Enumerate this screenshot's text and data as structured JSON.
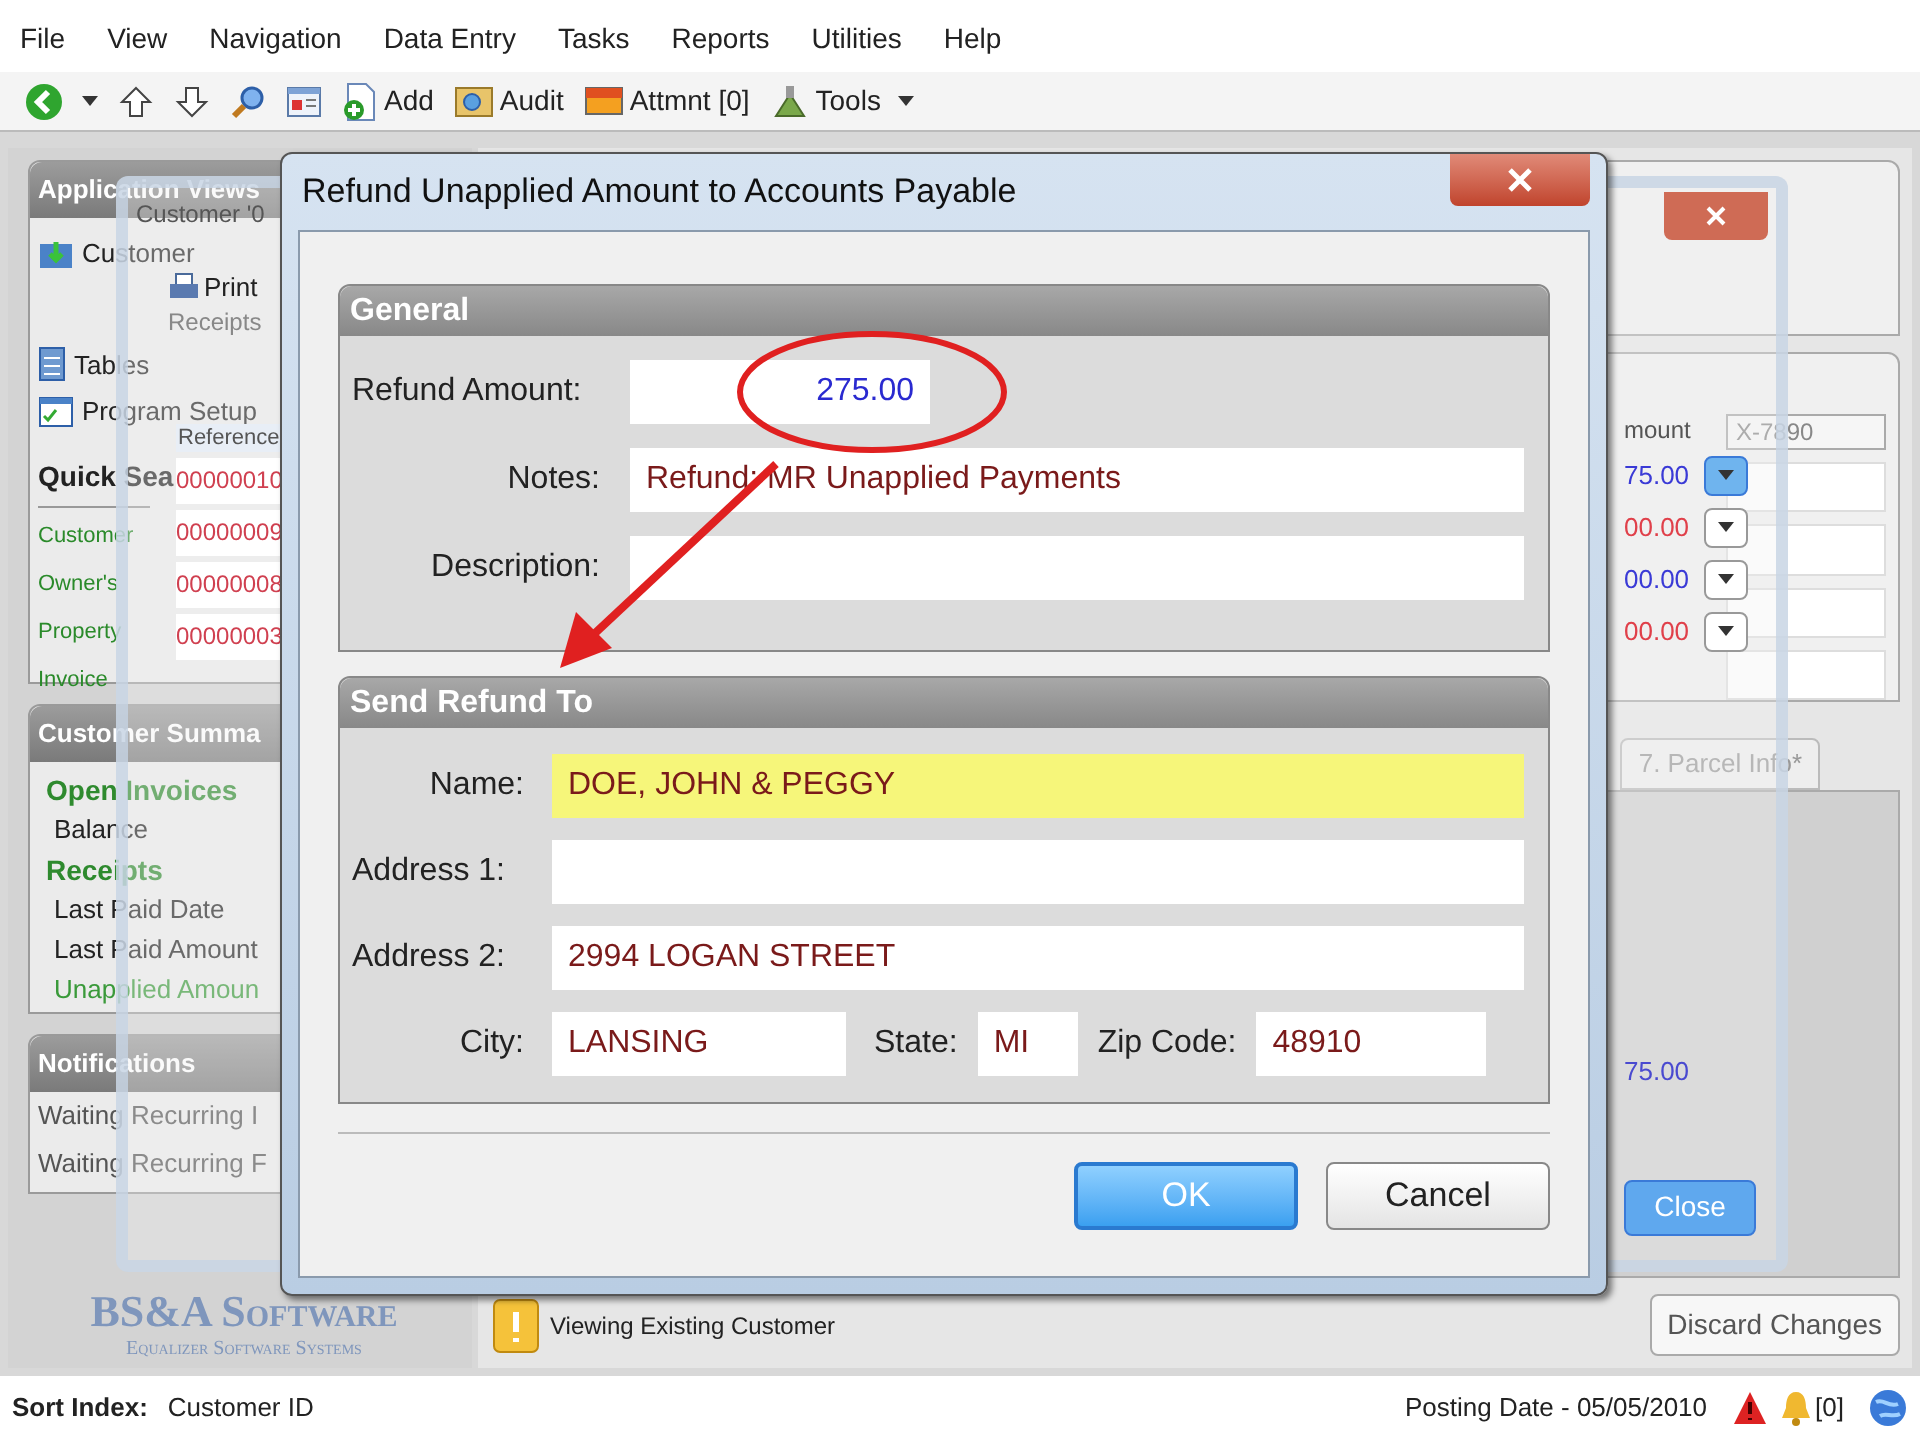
{
  "menu": [
    "File",
    "View",
    "Navigation",
    "Data Entry",
    "Tasks",
    "Reports",
    "Utilities",
    "Help"
  ],
  "toolbar": [
    {
      "kind": "back"
    },
    {
      "kind": "up"
    },
    {
      "kind": "down"
    },
    {
      "kind": "search"
    },
    {
      "kind": "form"
    },
    {
      "kind": "add",
      "label": "Add"
    },
    {
      "kind": "audit",
      "label": "Audit"
    },
    {
      "kind": "attachment",
      "label": "Attmnt [0]"
    },
    {
      "kind": "tools",
      "label": "Tools"
    }
  ],
  "left_panel": {
    "application_views": {
      "title": "Application Views",
      "items": [
        {
          "label": "Customer",
          "kind": "folder"
        },
        {
          "label": "Tables",
          "kind": "table"
        },
        {
          "label": "Program Setup",
          "kind": "setup"
        }
      ]
    },
    "quick_search": {
      "title": "Quick Sea",
      "items": [
        "Customer",
        "Owner's",
        "Property",
        "Invoice"
      ]
    },
    "customer_summary": {
      "title": "Customer Summa",
      "items": [
        {
          "label": "Open Invoices",
          "kind": "heading"
        },
        {
          "label": "Balance",
          "kind": "line"
        },
        {
          "label": "Receipts",
          "kind": "heading"
        },
        {
          "label": "Last Paid Date",
          "kind": "line"
        },
        {
          "label": "Last Paid Amount",
          "kind": "line"
        },
        {
          "label": "Unapplied Amoun",
          "kind": "link"
        }
      ]
    },
    "notifications": {
      "title": "Notifications",
      "items": [
        "Waiting Recurring I",
        "Waiting Recurring F"
      ]
    },
    "logo": {
      "name": "BS&A Software",
      "tagline": "Equalizer Software Systems"
    }
  },
  "main": {
    "search_value": "X-7890",
    "tab": "7. Parcel Info*",
    "status": "Viewing Existing Customer",
    "discard_button": "Discard Changes"
  },
  "customer_window": {
    "title": "Customer '0",
    "print_button": "Print",
    "receipts_label": "Receipts",
    "reference_header": "Reference",
    "amount_header": "mount",
    "rows": [
      {
        "reference": "00000010",
        "amount": "75.00",
        "color": "#3a3ad6",
        "selected": true
      },
      {
        "reference": "00000009",
        "amount": "00.00",
        "color": "#e0404a",
        "selected": false
      },
      {
        "reference": "00000008",
        "amount": "00.00",
        "color": "#3a3ad6",
        "selected": false
      },
      {
        "reference": "00000003",
        "amount": "00.00",
        "color": "#e0404a",
        "selected": false
      }
    ],
    "total": "75.00",
    "close_button": "Close"
  },
  "dialog": {
    "title": "Refund Unapplied Amount to Accounts Payable",
    "general": {
      "title": "General",
      "refund_amount": {
        "label": "Refund Amount:",
        "value": "275.00"
      },
      "notes": {
        "label": "Notes:",
        "value": "Refund: MR Unapplied Payments"
      },
      "description": {
        "label": "Description:"
      }
    },
    "send_refund_to": {
      "title": "Send Refund To",
      "name": {
        "label": "Name:",
        "value": "DOE, JOHN & PEGGY",
        "highlighted": true
      },
      "address1": {
        "label": "Address 1:"
      },
      "address2": {
        "label": "Address 2:",
        "value": "2994 LOGAN STREET"
      },
      "city": {
        "label": "City:",
        "value": "LANSING"
      },
      "state": {
        "label": "State:",
        "value": "MI"
      },
      "zip": {
        "label": "Zip Code:",
        "value": "48910"
      }
    },
    "buttons": [
      {
        "label": "OK",
        "default": true
      },
      {
        "label": "Cancel",
        "default": false
      }
    ]
  },
  "status_bar": {
    "sort_label": "Sort Index:",
    "sort_value": "Customer ID",
    "posting_date": "Posting Date - 05/05/2010",
    "alert_count": "[0]"
  }
}
